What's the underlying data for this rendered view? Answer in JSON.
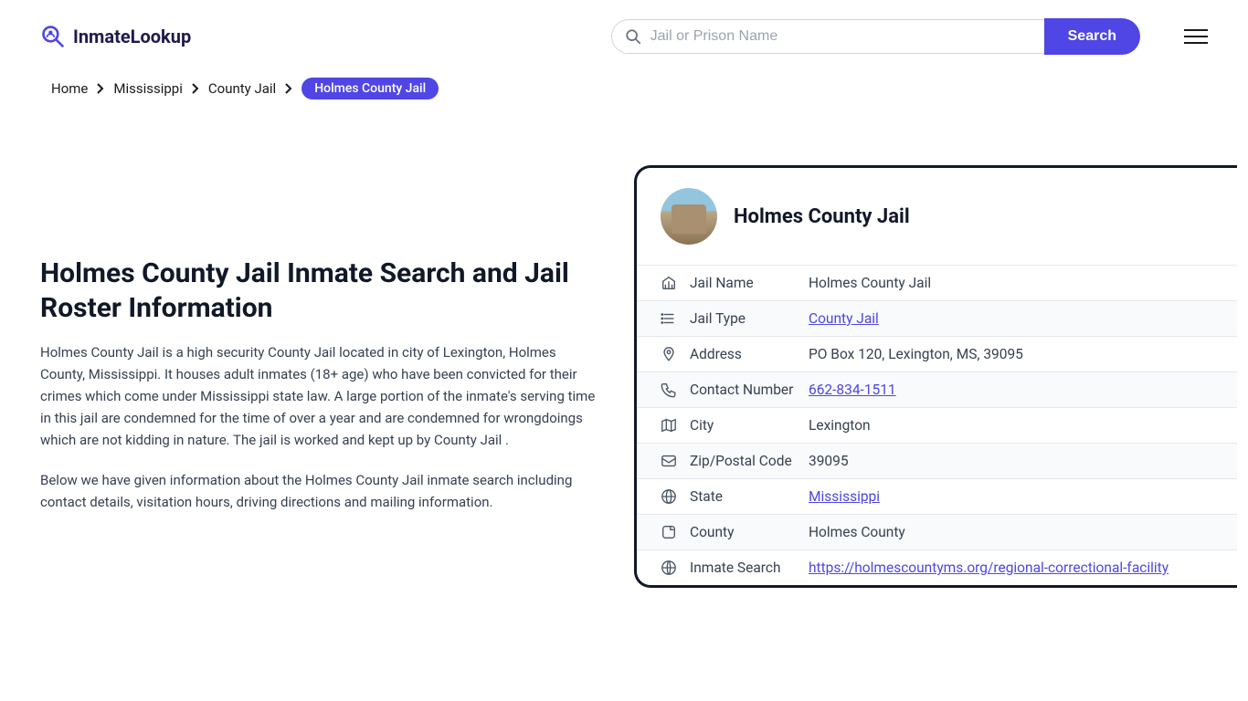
{
  "header": {
    "logo_text": "InmateLookup",
    "search_placeholder": "Jail or Prison Name",
    "search_button": "Search"
  },
  "breadcrumb": {
    "items": [
      "Home",
      "Mississippi",
      "County Jail"
    ],
    "current": "Holmes County Jail"
  },
  "content": {
    "title": "Holmes County Jail Inmate Search and Jail Roster Information",
    "para1": "Holmes County Jail is a high security County Jail located in city of Lexington, Holmes County, Mississippi. It houses adult inmates (18+ age) who have been convicted for their crimes which come under Mississippi state law. A large portion of the inmate's serving time in this jail are condemned for the time of over a year and are condemned for wrongdoings which are not kidding in nature. The jail is worked and kept up by County Jail .",
    "para2": "Below we have given information about the Holmes County Jail inmate search including contact details, visitation hours, driving directions and mailing information."
  },
  "card": {
    "title": "Holmes County Jail",
    "rows": [
      {
        "label": "Jail Name",
        "value": "Holmes County Jail",
        "link": false
      },
      {
        "label": "Jail Type",
        "value": "County Jail",
        "link": true
      },
      {
        "label": "Address",
        "value": "PO Box 120, Lexington, MS, 39095",
        "link": false
      },
      {
        "label": "Contact Number",
        "value": "662-834-1511",
        "link": true
      },
      {
        "label": "City",
        "value": "Lexington",
        "link": false
      },
      {
        "label": "Zip/Postal Code",
        "value": "39095",
        "link": false
      },
      {
        "label": "State",
        "value": "Mississippi",
        "link": true
      },
      {
        "label": "County",
        "value": "Holmes County",
        "link": false
      },
      {
        "label": "Inmate Search",
        "value": "https://holmescountyms.org/regional-correctional-facility",
        "link": true
      }
    ]
  }
}
